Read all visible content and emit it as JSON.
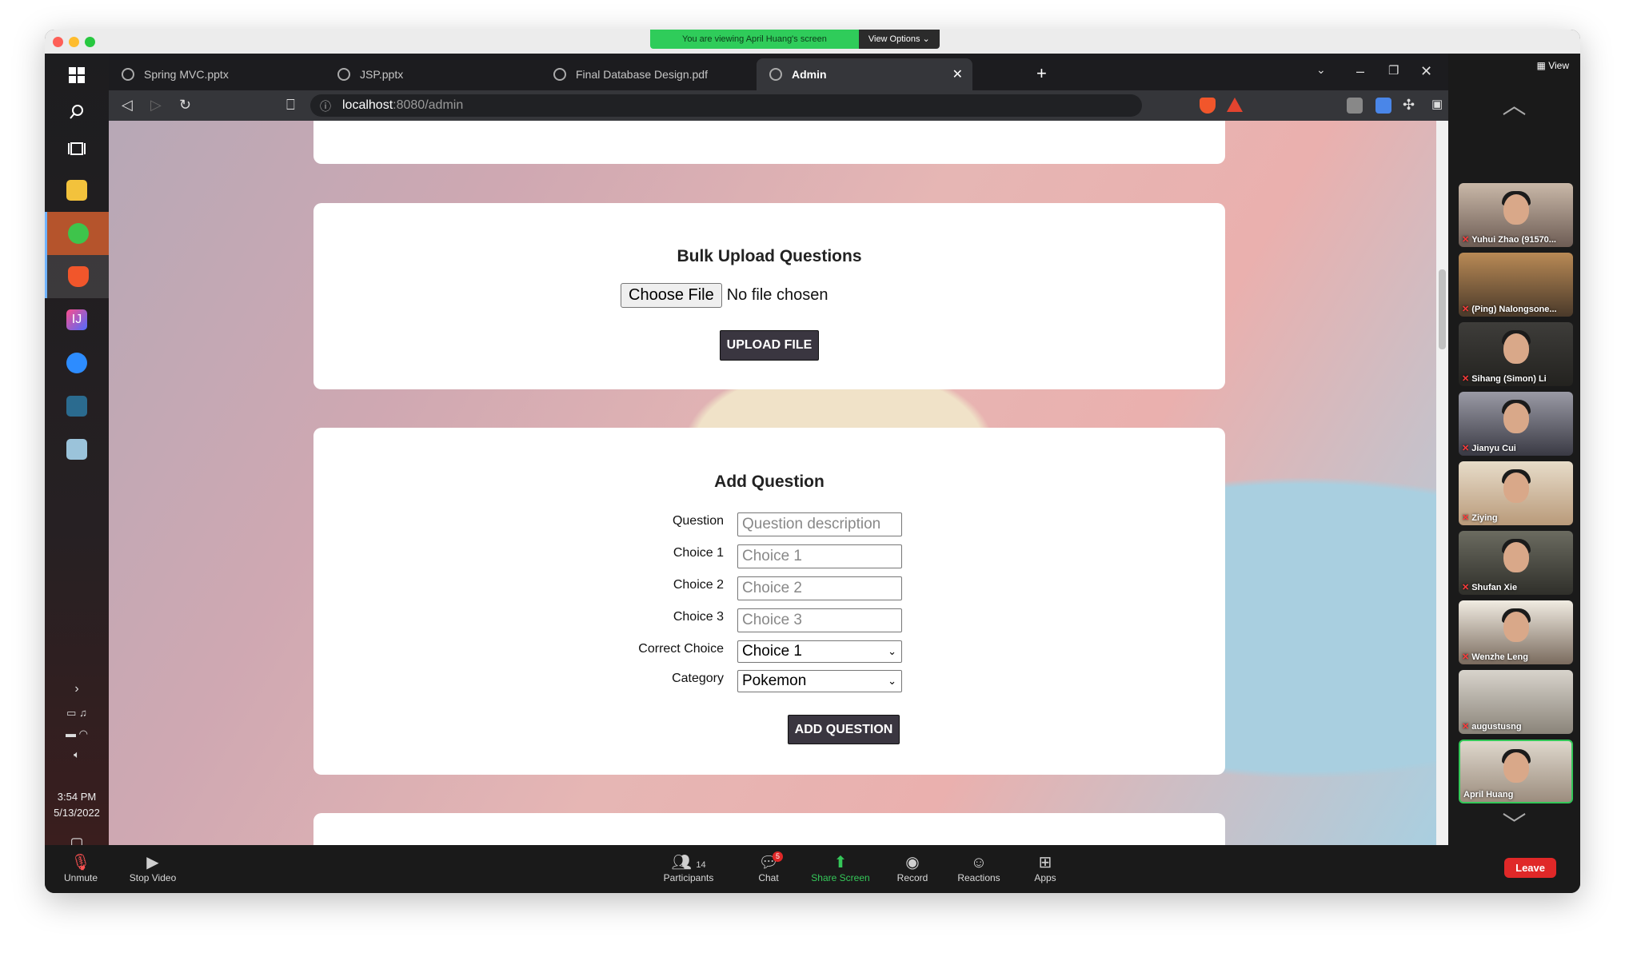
{
  "zoom": {
    "banner_text": "You are viewing April Huang's screen",
    "view_options": "View Options ⌄",
    "view_label": "View",
    "participants_count": "14",
    "chat_badge": "5",
    "controls": [
      {
        "label": "Unmute",
        "icon": "microphone-muted-icon"
      },
      {
        "label": "Stop Video",
        "icon": "video-camera-icon"
      },
      {
        "label": "Participants",
        "icon": "participants-icon"
      },
      {
        "label": "Chat",
        "icon": "chat-icon"
      },
      {
        "label": "Share Screen",
        "icon": "share-screen-icon"
      },
      {
        "label": "Record",
        "icon": "record-icon"
      },
      {
        "label": "Reactions",
        "icon": "reactions-icon"
      },
      {
        "label": "Apps",
        "icon": "apps-icon"
      }
    ],
    "leave_label": "Leave",
    "participants": [
      {
        "name": "Yuhui Zhao (91570..."
      },
      {
        "name": "(Ping) Nalongsone..."
      },
      {
        "name": "Sihang (Simon) Li"
      },
      {
        "name": "Jianyu Cui"
      },
      {
        "name": "Ziying"
      },
      {
        "name": "Shufan Xie"
      },
      {
        "name": "Wenzhe Leng"
      },
      {
        "name": "augustusng"
      },
      {
        "name": "April Huang"
      }
    ],
    "accent_green": "#34c759",
    "leave_red": "#e02828"
  },
  "taskbar": {
    "time": "3:54 PM",
    "date": "5/13/2022"
  },
  "browser": {
    "tabs": [
      {
        "label": "Spring MVC.pptx"
      },
      {
        "label": "JSP.pptx"
      },
      {
        "label": "Final Database Design.pdf"
      },
      {
        "label": "Admin"
      }
    ],
    "url_host": "localhost",
    "url_path": ":8080/admin"
  },
  "page": {
    "bulk": {
      "title": "Bulk Upload Questions",
      "choose_file": "Choose File",
      "no_file": "No file chosen",
      "upload_button": "UPLOAD FILE"
    },
    "add": {
      "title": "Add Question",
      "question_label": "Question",
      "question_placeholder": "Question description",
      "choice1_label": "Choice 1",
      "choice1_placeholder": "Choice 1",
      "choice2_label": "Choice 2",
      "choice2_placeholder": "Choice 2",
      "choice3_label": "Choice 3",
      "choice3_placeholder": "Choice 3",
      "correct_label": "Correct Choice",
      "correct_value": "Choice 1",
      "category_label": "Category",
      "category_value": "Pokemon",
      "add_button": "ADD QUESTION"
    }
  }
}
